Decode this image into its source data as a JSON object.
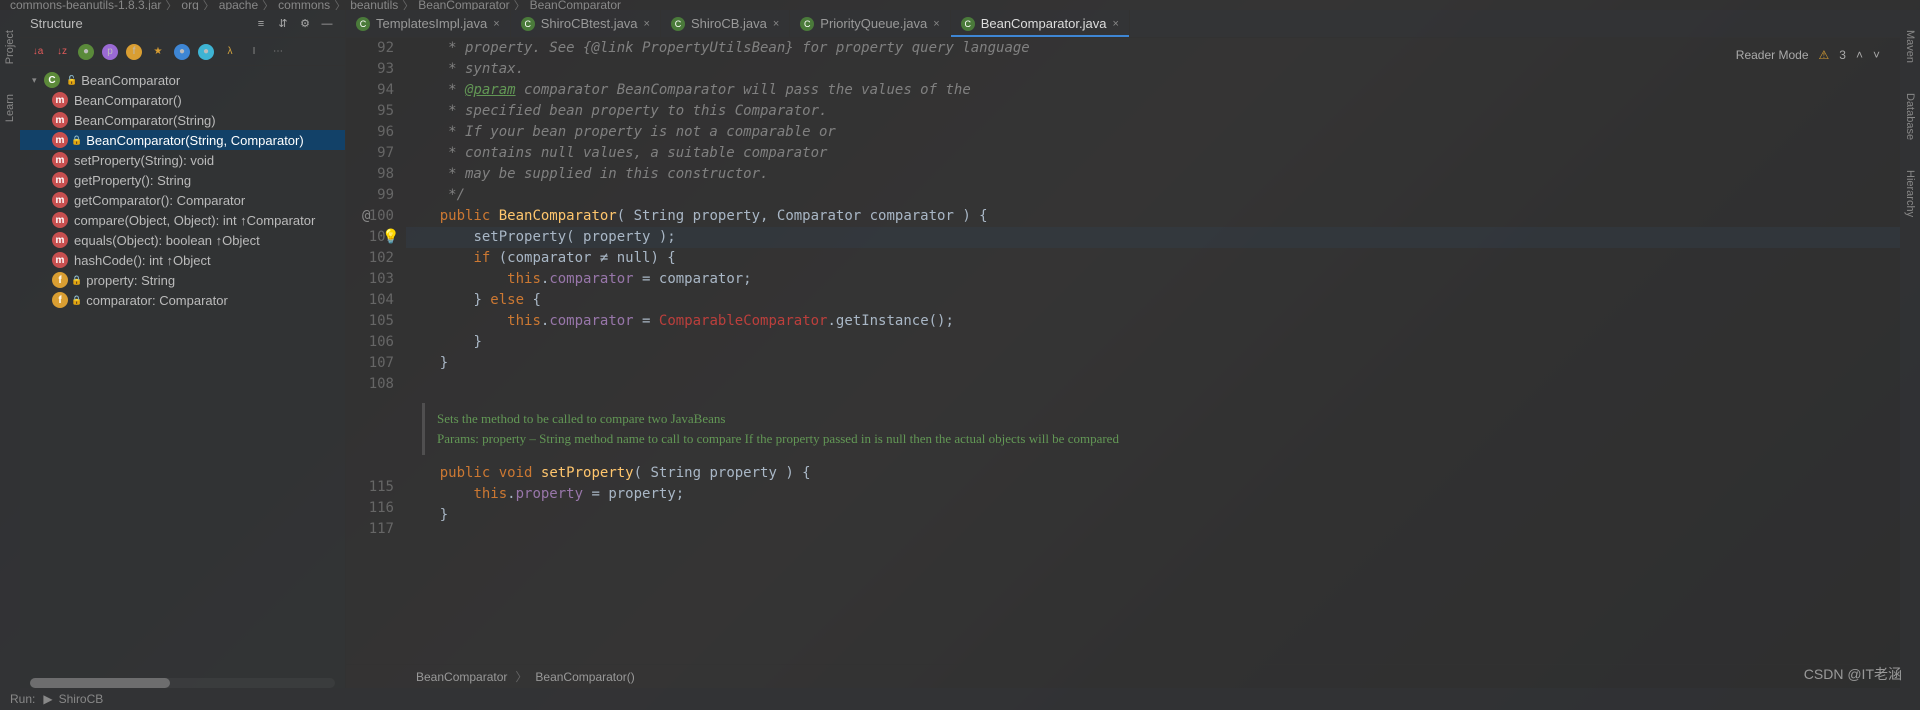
{
  "breadcrumb": [
    "commons-beanutils-1.8.3.jar",
    "org",
    "apache",
    "commons",
    "beanutils",
    "BeanComparator",
    "BeanComparator"
  ],
  "structure": {
    "title": "Structure",
    "root": "BeanComparator",
    "items": [
      {
        "k": "m",
        "label": "BeanComparator()"
      },
      {
        "k": "m",
        "label": "BeanComparator(String)"
      },
      {
        "k": "m",
        "label": "BeanComparator(String, Comparator)",
        "sel": true
      },
      {
        "k": "m",
        "label": "setProperty(String): void"
      },
      {
        "k": "m",
        "label": "getProperty(): String"
      },
      {
        "k": "m",
        "label": "getComparator(): Comparator"
      },
      {
        "k": "m",
        "label": "compare(Object, Object): int ↑Comparator"
      },
      {
        "k": "m",
        "label": "equals(Object): boolean ↑Object"
      },
      {
        "k": "m",
        "label": "hashCode(): int ↑Object"
      },
      {
        "k": "f",
        "label": "property: String",
        "lock": true
      },
      {
        "k": "f",
        "label": "comparator: Comparator",
        "lock": true
      }
    ]
  },
  "tabs": [
    {
      "label": "TemplatesImpl.java"
    },
    {
      "label": "ShiroCBtest.java"
    },
    {
      "label": "ShiroCB.java"
    },
    {
      "label": "PriorityQueue.java"
    },
    {
      "label": "BeanComparator.java",
      "active": true
    }
  ],
  "reader": {
    "label": "Reader Mode",
    "warn": "3"
  },
  "gutter": [
    "92",
    "93",
    "94",
    "95",
    "96",
    "97",
    "98",
    "99",
    "100",
    "101",
    "102",
    "103",
    "104",
    "105",
    "106",
    "107",
    "108",
    "",
    "",
    "",
    "115",
    "116",
    "117"
  ],
  "code": {
    "c92": "     * property. See {@link PropertyUtilsBean} for property query language",
    "c93": "     * syntax.",
    "c94a": "     * ",
    "c94b": "@param",
    "c94c": " comparator BeanComparator will pass the values of the",
    "c95": "     * specified bean property to this Comparator.",
    "c96": "     * If your bean property is not a comparable or",
    "c97": "     * contains null values, a suitable comparator",
    "c98": "     * may be supplied in this constructor.",
    "c99": "     */",
    "l100_public": "public ",
    "l100_name": "BeanComparator",
    "l100_sig": "( String property, Comparator comparator ) {",
    "l101_call": "setProperty",
    "l101_args": "( property );",
    "l102_if": "if ",
    "l102_cond": "(comparator ≠ null) {",
    "l103_this": "this",
    "l103_dot": ".",
    "l103_fd": "comparator",
    "l103_assign": " = comparator;",
    "l104": "} ",
    "l104_else": "else ",
    "l104_brace": "{",
    "l105_this": "this",
    "l105_dot": ".",
    "l105_fd": "comparator",
    "l105_assign": " = ",
    "l105_cls": "ComparableComparator",
    "l105_call": ".getInstance();",
    "l106": "}",
    "l107": "}",
    "l115_public": "public ",
    "l115_void": "void ",
    "l115_name": "setProperty",
    "l115_sig": "( String property ) {",
    "l116_this": "this",
    "l116_dot": ".",
    "l116_fd": "property",
    "l116_assign": " = property;",
    "l117": "}"
  },
  "doc": {
    "summary": "Sets the method to be called to compare two JavaBeans",
    "params": "Params: property – String method name to call to compare If the property passed in is null then the actual objects will be compared"
  },
  "crumb": [
    "BeanComparator",
    "BeanComparator()"
  ],
  "footer": {
    "run": "Run:",
    "config": "ShiroCB"
  },
  "rails": {
    "left": [
      "Project",
      "Learn"
    ],
    "right": [
      "Maven",
      "Database",
      "Hierarchy"
    ]
  },
  "watermark": "CSDN @IT老涵"
}
